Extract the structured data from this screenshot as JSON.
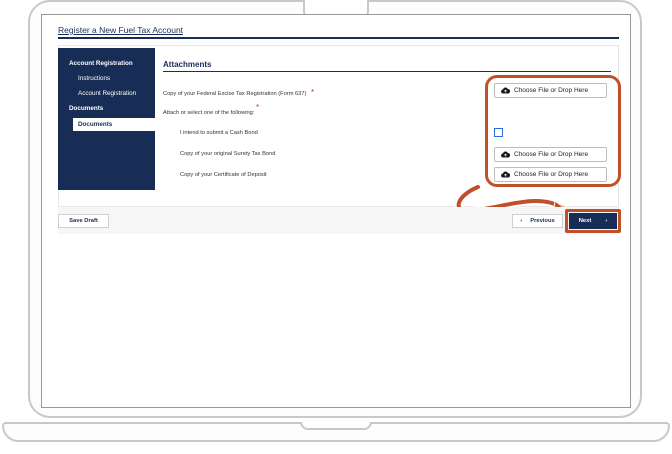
{
  "page": {
    "title": "Register a New Fuel Tax Account"
  },
  "sidebar": {
    "items": [
      {
        "label": "Account Registration"
      },
      {
        "label": "Instructions"
      },
      {
        "label": "Account Registration"
      },
      {
        "label": "Documents"
      },
      {
        "label": "Documents"
      }
    ]
  },
  "attachments": {
    "heading": "Attachments",
    "form637_label": "Copy of your Federal Excise Tax Registration (Form 637)",
    "attach_label": "Attach or select one of the following:",
    "required_mark": "*",
    "options": [
      {
        "label": "I intend to submit a Cash Bond"
      },
      {
        "label": "Copy of your original Surety Tax Bond"
      },
      {
        "label": "Copy of your Certificate of Deposit"
      }
    ],
    "file_button_label": "Choose File or Drop Here"
  },
  "footer": {
    "save_label": "Save Draft",
    "previous_label": "Previous",
    "next_label": "Next",
    "prev_chevron": "‹",
    "next_chevron": "›"
  },
  "colors": {
    "navy": "#182d55",
    "callout": "#c0502a",
    "required": "#c0392b",
    "checkbox": "#2a6fd6"
  }
}
